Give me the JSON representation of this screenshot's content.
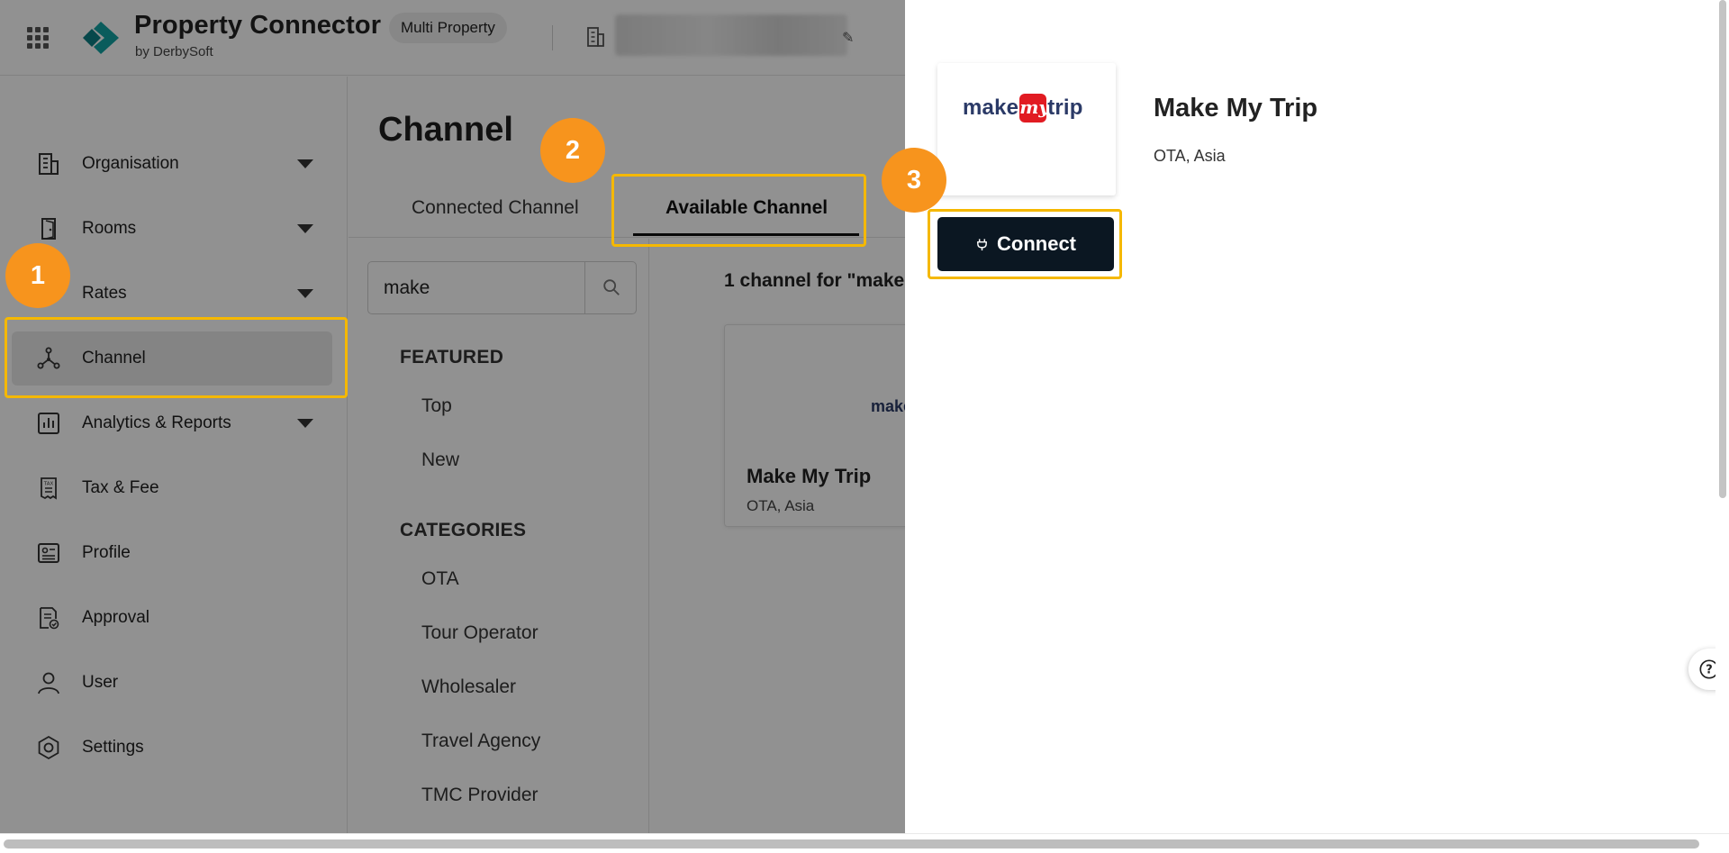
{
  "header": {
    "brand_title": "Property Connector",
    "brand_subtitle": "by DerbySoft",
    "mode_label": "Multi Property",
    "property_edit_icon": "✎"
  },
  "sidebar": {
    "items": [
      {
        "label": "Organisation",
        "icon": "building-icon",
        "has_caret": true
      },
      {
        "label": "Rooms",
        "icon": "door-icon",
        "has_caret": true
      },
      {
        "label": "Rates",
        "icon": "tag-icon",
        "has_caret": true
      },
      {
        "label": "Channel",
        "icon": "network-icon",
        "active": true
      },
      {
        "label": "Analytics & Reports",
        "icon": "chart-icon",
        "has_caret": true
      },
      {
        "label": "Tax & Fee",
        "icon": "receipt-icon"
      },
      {
        "label": "Profile",
        "icon": "id-card-icon"
      },
      {
        "label": "Approval",
        "icon": "document-check-icon"
      },
      {
        "label": "User",
        "icon": "user-icon"
      },
      {
        "label": "Settings",
        "icon": "gear-icon"
      }
    ]
  },
  "main": {
    "page_title": "Channel",
    "tabs": [
      {
        "label": "Connected Channel"
      },
      {
        "label": "Available Channel",
        "active": true
      }
    ],
    "search": {
      "value": "make"
    },
    "filters": {
      "featured_heading": "FEATURED",
      "featured": [
        "Top",
        "New"
      ],
      "categories_heading": "CATEGORIES",
      "categories": [
        "OTA",
        "Tour Operator",
        "Wholesaler",
        "Travel Agency",
        "TMC Provider"
      ]
    },
    "results_title": "1 channel for \"make",
    "card": {
      "logo_text": "make",
      "name": "Make My Trip",
      "meta": "OTA, Asia"
    }
  },
  "drawer": {
    "logo": {
      "make": "make",
      "my": "my",
      "trip": "trip"
    },
    "name": "Make My Trip",
    "meta": "OTA, Asia",
    "connect_label": "Connect",
    "help_icon": "?"
  },
  "annotations": {
    "step_1": "1",
    "step_2": "2",
    "step_3": "3"
  },
  "colors": {
    "accent_highlight": "#f5b800",
    "step_badge": "#f7941d",
    "brand_teal": "#12a3a3",
    "connect_button": "#0b1722",
    "mmt_red": "#e11b22"
  }
}
